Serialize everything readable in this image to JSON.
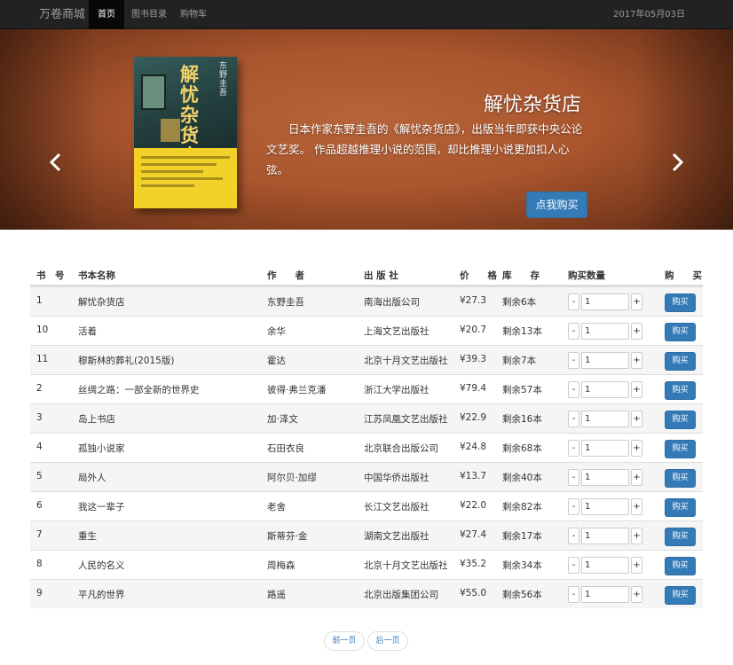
{
  "navbar": {
    "brand": "万卷商城",
    "items": [
      {
        "label": "首页",
        "active": true
      },
      {
        "label": "图书目录",
        "active": false
      },
      {
        "label": "购物车",
        "active": false
      }
    ],
    "date": "2017年05月03日"
  },
  "carousel": {
    "book_cover_title": "解忧杂货店",
    "book_cover_author": "东野圭吾",
    "title": "解忧杂货店",
    "description": "日本作家东野圭吾的《解忧杂货店》，出版当年即获中央公论文艺奖。 作品超越推理小说的范围，却比推理小说更加扣人心弦。",
    "buy_label": "点我购买",
    "slide_count": 3,
    "active_slide": 1
  },
  "table": {
    "headers": {
      "id": "书　号",
      "name": "书本名称",
      "author": "作　　者",
      "publisher": "出 版 社",
      "price": "价　　格",
      "stock": "库　　存",
      "qty": "购买数量",
      "buy": "购　　买"
    },
    "buy_label": "购买",
    "minus_label": "-",
    "plus_label": "+",
    "rows": [
      {
        "id": "1",
        "name": "解忧杂货店",
        "author": "东野圭吾",
        "publisher": "南海出版公司",
        "price": "¥27.3",
        "stock": "剩余6本",
        "qty": "1"
      },
      {
        "id": "10",
        "name": "活着",
        "author": "余华",
        "publisher": "上海文艺出版社",
        "price": "¥20.7",
        "stock": "剩余13本",
        "qty": "1"
      },
      {
        "id": "11",
        "name": "穆斯林的葬礼(2015版)",
        "author": "霍达",
        "publisher": "北京十月文艺出版社",
        "price": "¥39.3",
        "stock": "剩余7本",
        "qty": "1"
      },
      {
        "id": "2",
        "name": "丝绸之路：一部全新的世界史",
        "author": "彼得·弗兰克潘",
        "publisher": "浙江大学出版社",
        "price": "¥79.4",
        "stock": "剩余57本",
        "qty": "1"
      },
      {
        "id": "3",
        "name": "岛上书店",
        "author": "加·泽文",
        "publisher": "江苏凤凰文艺出版社",
        "price": "¥22.9",
        "stock": "剩余16本",
        "qty": "1"
      },
      {
        "id": "4",
        "name": "孤独小说家",
        "author": "石田衣良",
        "publisher": "北京联合出版公司",
        "price": "¥24.8",
        "stock": "剩余68本",
        "qty": "1"
      },
      {
        "id": "5",
        "name": "局外人",
        "author": "阿尔贝·加缪",
        "publisher": "中国华侨出版社",
        "price": "¥13.7",
        "stock": "剩余40本",
        "qty": "1"
      },
      {
        "id": "6",
        "name": "我这一辈子",
        "author": "老舍",
        "publisher": "长江文艺出版社",
        "price": "¥22.0",
        "stock": "剩余82本",
        "qty": "1"
      },
      {
        "id": "7",
        "name": "重生",
        "author": "斯蒂芬·金",
        "publisher": "湖南文艺出版社",
        "price": "¥27.4",
        "stock": "剩余17本",
        "qty": "1"
      },
      {
        "id": "8",
        "name": "人民的名义",
        "author": "周梅森",
        "publisher": "北京十月文艺出版社",
        "price": "¥35.2",
        "stock": "剩余34本",
        "qty": "1"
      },
      {
        "id": "9",
        "name": "平凡的世界",
        "author": "路遥",
        "publisher": "北京出版集团公司",
        "price": "¥55.0",
        "stock": "剩余56本",
        "qty": "1"
      }
    ]
  },
  "pager": {
    "prev_label": "前一页",
    "next_label": "后一页"
  },
  "colors": {
    "navbar_bg": "#222222",
    "primary": "#337ab7",
    "carousel_bg": "#a9552d"
  }
}
